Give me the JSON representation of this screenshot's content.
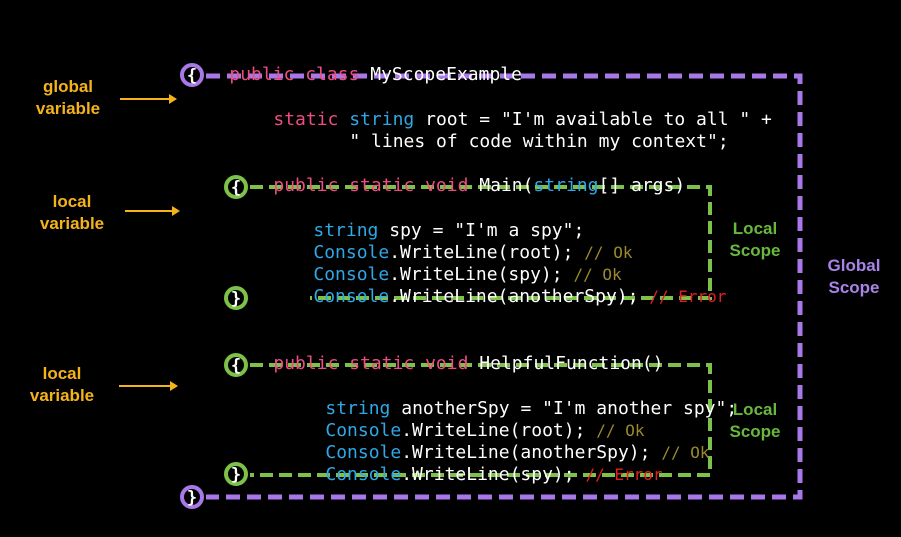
{
  "code": {
    "class_decl": {
      "kw": "public class",
      "name": "MyScopeExample"
    },
    "root_decl": {
      "kw": "static",
      "type": "string",
      "text": "root = \"I'm available to all \" +"
    },
    "root_cont": "\" lines of code within my context\";",
    "main_decl": {
      "kw": "public static void",
      "name": "Main(",
      "type": "string",
      "rest": "[] args)"
    },
    "main_body": [
      {
        "type": "string",
        "text": "spy = \"I'm a spy\";"
      },
      {
        "type": "Console",
        "text": ".WriteLine(root);",
        "comment": "// Ok",
        "error": false
      },
      {
        "type": "Console",
        "text": ".WriteLine(spy);",
        "comment": "// Ok",
        "error": false
      },
      {
        "type": "Console",
        "text": ".WriteLine(anotherSpy);",
        "comment": "// Error",
        "error": true
      }
    ],
    "helper_decl": {
      "kw": "public static void",
      "name": "HelpfulFunction()"
    },
    "helper_body": [
      {
        "type": "string",
        "text": "anotherSpy = \"I'm another spy\";"
      },
      {
        "type": "Console",
        "text": ".WriteLine(root);",
        "comment": "// Ok",
        "error": false
      },
      {
        "type": "Console",
        "text": ".WriteLine(anotherSpy);",
        "comment": "// Ok",
        "error": false
      },
      {
        "type": "Console",
        "text": ".WriteLine(spy);",
        "comment": "// Error",
        "error": true
      }
    ]
  },
  "braces": {
    "open": "{",
    "close": "}"
  },
  "labels": {
    "global_variable": [
      "global",
      "variable"
    ],
    "local_variable_1": [
      "local",
      "variable"
    ],
    "local_variable_2": [
      "local",
      "variable"
    ],
    "local_scope_1": [
      "Local",
      "Scope"
    ],
    "local_scope_2": [
      "Local",
      "Scope"
    ],
    "global_scope": [
      "Global",
      "Scope"
    ]
  },
  "colors": {
    "keyword": "#ee4d82",
    "type": "#2ea8e6",
    "ok_comment": "#9a8a2a",
    "error_comment": "#e02020",
    "global_scope": "#a878e8",
    "local_scope": "#7dc14a",
    "variable_label": "#f5b31a"
  }
}
